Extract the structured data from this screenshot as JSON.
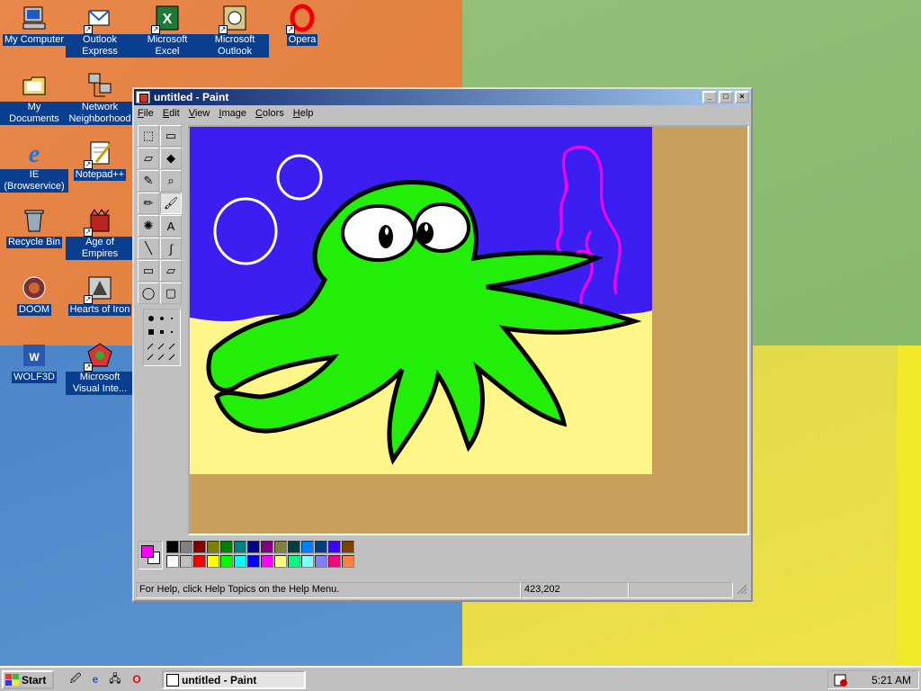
{
  "desktop": {
    "icons": [
      {
        "label": "My Computer",
        "icon": "computer-icon"
      },
      {
        "label": "Outlook Express",
        "icon": "outlook-express-icon"
      },
      {
        "label": "Microsoft Excel",
        "icon": "excel-icon"
      },
      {
        "label": "Microsoft Outlook",
        "icon": "outlook-icon"
      },
      {
        "label": "Opera",
        "icon": "opera-icon"
      },
      {
        "label": "My Documents",
        "icon": "folder-icon"
      },
      {
        "label": "Network Neighborhood",
        "icon": "network-icon"
      },
      {
        "label": "IE (Browservice)",
        "icon": "ie-icon"
      },
      {
        "label": "Notepad++",
        "icon": "notepad-icon"
      },
      {
        "label": "Recycle Bin",
        "icon": "recycle-bin-icon"
      },
      {
        "label": "Age of Empires",
        "icon": "age-of-empires-icon"
      },
      {
        "label": "DOOM",
        "icon": "doom-icon"
      },
      {
        "label": "Hearts of Iron",
        "icon": "hearts-of-iron-icon"
      },
      {
        "label": "WOLF3D",
        "icon": "wolf3d-icon"
      },
      {
        "label": "Microsoft Visual Inte...",
        "icon": "visual-interdev-icon"
      }
    ]
  },
  "window": {
    "title": "untitled - Paint",
    "controls": {
      "minimize": "_",
      "maximize": "□",
      "close": "×"
    },
    "menu": [
      "File",
      "Edit",
      "View",
      "Image",
      "Colors",
      "Help"
    ]
  },
  "tools": [
    "free-select-icon",
    "rect-select-icon",
    "eraser-icon",
    "fill-icon",
    "color-picker-icon",
    "magnifier-icon",
    "pencil-icon",
    "brush-icon",
    "airbrush-icon",
    "text-icon",
    "line-icon",
    "curve-icon",
    "rectangle-icon",
    "polygon-icon",
    "ellipse-icon",
    "rounded-rect-icon"
  ],
  "tool_glyphs": [
    "⬚",
    "▭",
    "▱",
    "◆",
    "✎",
    "⌕",
    "✏",
    "🖌",
    "✺",
    "A",
    "╲",
    "∫",
    "▭",
    "▱",
    "◯",
    "▢"
  ],
  "palette": {
    "foreground": "#ff00ff",
    "background": "#ffffff",
    "row1": [
      "#000000",
      "#808080",
      "#800000",
      "#808000",
      "#008000",
      "#008080",
      "#000080",
      "#800080",
      "#808040",
      "#004040",
      "#0080ff",
      "#004080",
      "#4000ff",
      "#804000"
    ],
    "row2": [
      "#ffffff",
      "#c0c0c0",
      "#ff0000",
      "#ffff00",
      "#00ff00",
      "#00ffff",
      "#0000ff",
      "#ff00ff",
      "#ffff80",
      "#00ff80",
      "#80ffff",
      "#8080ff",
      "#ff0080",
      "#ff8040"
    ]
  },
  "canvas": {
    "colors": {
      "sky": "#3c1ff0",
      "sand": "#fff68a",
      "octopus": "#22ee0a",
      "outline": "#000000",
      "coral": "#ff00ff",
      "bubble": "#ffffff",
      "workspace": "#c9a05b"
    }
  },
  "statusbar": {
    "help": "For Help, click Help Topics on the Help Menu.",
    "coords": "423,202",
    "size": ""
  },
  "taskbar": {
    "start": "Start",
    "quick_launch": [
      "show-desktop-icon",
      "ie-icon",
      "channels-icon",
      "opera-icon"
    ],
    "task": "untitled - Paint",
    "clock": "5:21 AM"
  }
}
